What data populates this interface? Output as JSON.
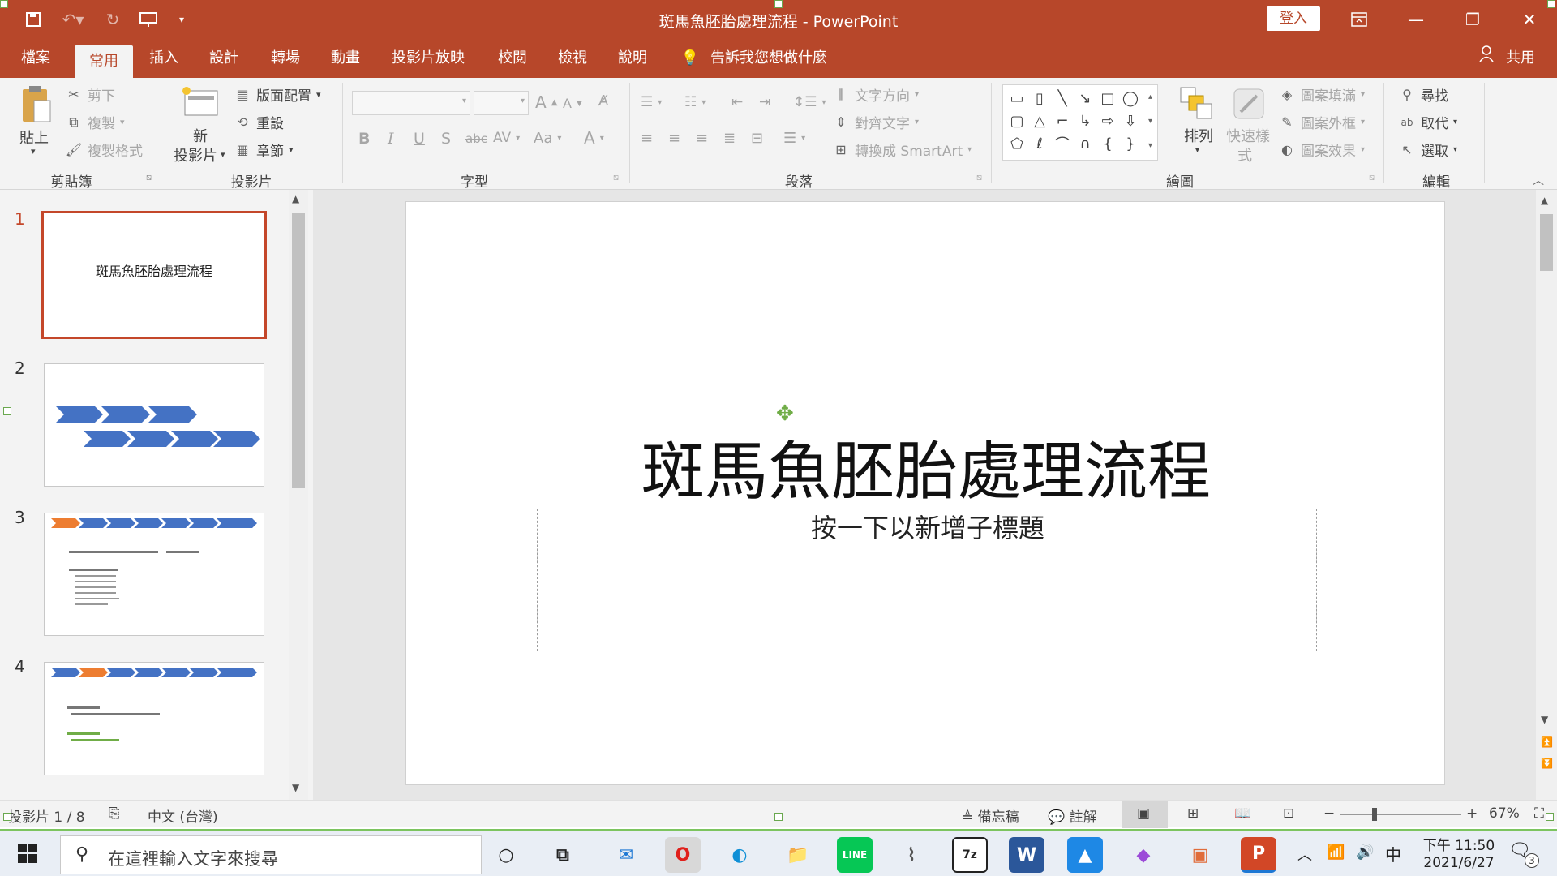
{
  "window": {
    "title": "斑馬魚胚胎處理流程 - PowerPoint",
    "signin_label": "登入",
    "share_label": "共用",
    "tell_me": "告訴我您想做什麼"
  },
  "tabs": [
    "檔案",
    "常用",
    "插入",
    "設計",
    "轉場",
    "動畫",
    "投影片放映",
    "校閱",
    "檢視",
    "說明"
  ],
  "ribbon": {
    "clipboard": {
      "paste": "貼上",
      "cut": "剪下",
      "copy": "複製",
      "format_painter": "複製格式",
      "label": "剪貼簿"
    },
    "slides": {
      "new_slide_1": "新",
      "new_slide_2": "投影片",
      "layout": "版面配置",
      "reset": "重設",
      "section": "章節",
      "label": "投影片"
    },
    "font": {
      "label": "字型"
    },
    "paragraph": {
      "text_direction": "文字方向",
      "align_text": "對齊文字",
      "convert_smartart": "轉換成 SmartArt",
      "label": "段落"
    },
    "drawing": {
      "arrange": "排列",
      "quick_styles_1": "快速樣",
      "quick_styles_2": "式",
      "shape_fill": "圖案填滿",
      "shape_outline": "圖案外框",
      "shape_effects": "圖案效果",
      "label": "繪圖"
    },
    "editing": {
      "find": "尋找",
      "replace": "取代",
      "select": "選取",
      "label": "編輯"
    }
  },
  "thumbnails": {
    "numbers": [
      "1",
      "2",
      "3",
      "4"
    ],
    "slide1_title": "斑馬魚胚胎處理流程"
  },
  "slide": {
    "title": "斑馬魚胚胎處理流程",
    "subtitle_placeholder": "按一下以新增子標題"
  },
  "status": {
    "slide_info": "投影片 1 / 8",
    "language": "中文 (台灣)",
    "notes": "備忘稿",
    "comments": "註解",
    "zoom": "67%"
  },
  "taskbar": {
    "search_placeholder": "在這裡輸入文字來搜尋",
    "ime": "中",
    "time": "下午 11:50",
    "date": "2021/6/27",
    "notification_count": "3"
  }
}
